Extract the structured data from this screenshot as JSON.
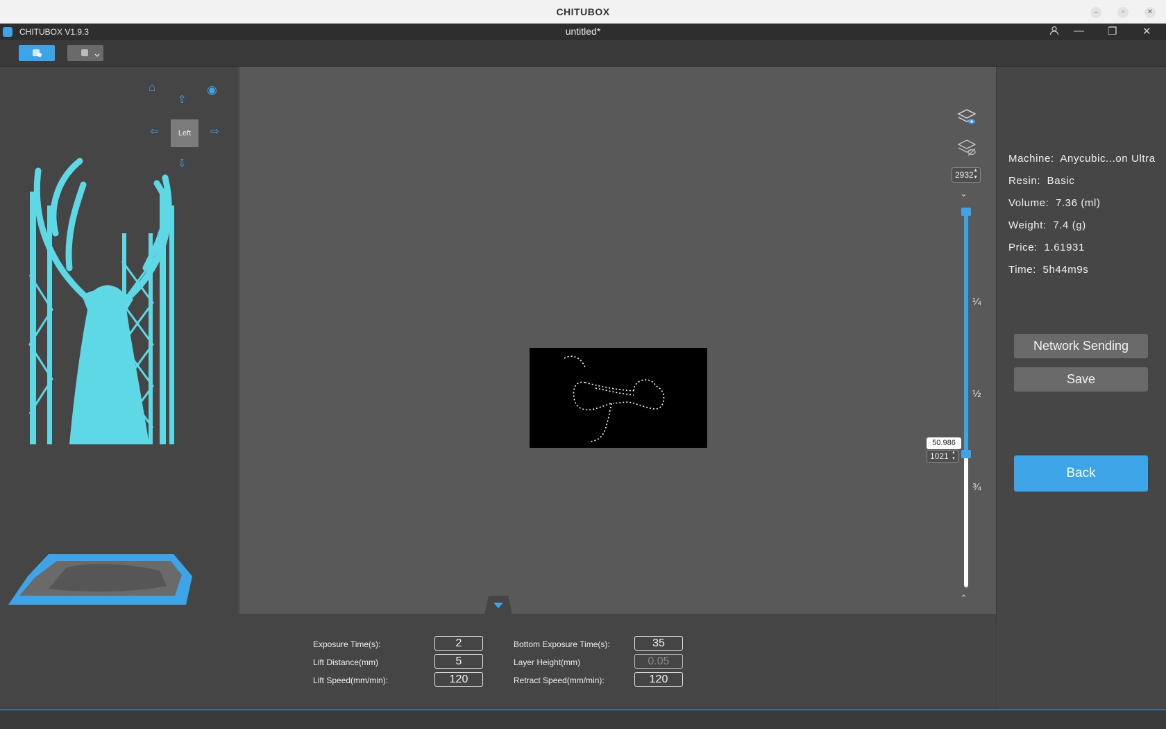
{
  "os": {
    "title": "CHITUBOX"
  },
  "app": {
    "name": "CHITUBOX V1.9.3",
    "document_title": "untitled*"
  },
  "left": {
    "tooltip": "Left"
  },
  "slider": {
    "top_layer": "2932",
    "current_layer": "1021",
    "current_height": "50.986",
    "current_fraction": 0.348,
    "marks": [
      "¼",
      "½",
      "¾"
    ]
  },
  "info": {
    "machine_label": "Machine:",
    "machine_value": "Anycubic...on Ultra",
    "resin_label": "Resin:",
    "resin_value": "Basic",
    "volume_label": "Volume:",
    "volume_value": "7.36 (ml)",
    "weight_label": "Weight:",
    "weight_value": "7.4 (g)",
    "price_label": "Price:",
    "price_value": "1.61931",
    "time_label": "Time:",
    "time_value": "5h44m9s"
  },
  "buttons": {
    "network": "Network Sending",
    "save": "Save",
    "back": "Back"
  },
  "params": {
    "exposure_label": "Exposure Time(s):",
    "exposure_value": "2",
    "lift_distance_label": "Lift Distance(mm)",
    "lift_distance_value": "5",
    "lift_speed_label": "Lift Speed(mm/min):",
    "lift_speed_value": "120",
    "bottom_exposure_label": "Bottom Exposure Time(s):",
    "bottom_exposure_value": "35",
    "layer_height_label": "Layer Height(mm)",
    "layer_height_value": "0.05",
    "retract_speed_label": "Retract Speed(mm/min):",
    "retract_speed_value": "120"
  },
  "colors": {
    "accent": "#3ea4e8",
    "model": "#5fd8e6",
    "panel": "#454545",
    "viewport": "#595959"
  }
}
